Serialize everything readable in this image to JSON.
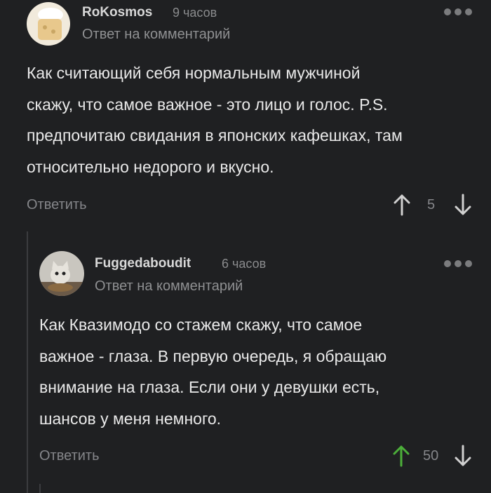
{
  "comments": [
    {
      "username": "RoKosmos",
      "time": "9 часов",
      "reply_to": "Ответ на комментарий",
      "text": "Как считающий себя нормальным мужчиной\nскажу, что самое важное - это лицо и голос.  P.S.\nпредпочитаю свидания в японских кафешках, там\nотносительно недорого и вкусно.",
      "reply_button": "Ответить",
      "score": "5",
      "upvoted": false
    },
    {
      "username": "Fuggedaboudit",
      "time": "6 часов",
      "reply_to": "Ответ на комментарий",
      "text": "Как Квазимодо со стажем скажу, что самое\nважное - глаза. В первую очередь, я обращаю\nвнимание на глаза. Если они у девушки есть,\nшансов у меня немного.",
      "reply_button": "Ответить",
      "score": "50",
      "upvoted": true
    }
  ],
  "colors": {
    "background": "#1f2022",
    "upvote_active": "#4caf3a",
    "icon_default": "#d0d0d0"
  },
  "icons": [
    "more-dots-icon",
    "arrow-up-icon",
    "arrow-down-icon"
  ]
}
